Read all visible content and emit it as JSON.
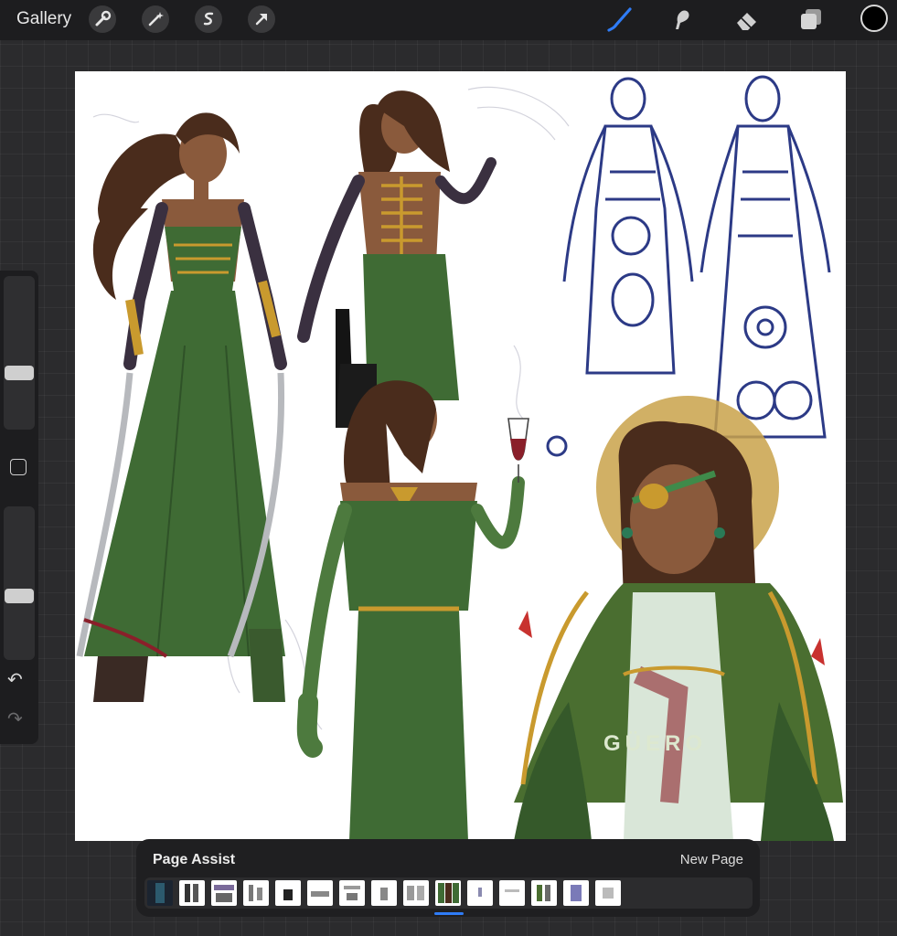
{
  "toolbar": {
    "gallery_label": "Gallery",
    "left_tools": [
      "wrench-icon",
      "magic-wand-icon",
      "selection-icon",
      "transform-arrow-icon"
    ],
    "right_tools": [
      "brush-icon",
      "smudge-icon",
      "eraser-icon",
      "layers-icon"
    ],
    "active_tool": "brush-icon",
    "current_color": "#000000",
    "accent_color": "#2f7cf6"
  },
  "canvas": {
    "watermark": "GÜERO",
    "colors": {
      "dress_green": "#3f6b34",
      "gold": "#c99a2e",
      "skin": "#8a5a3c",
      "hair": "#4a2c1c",
      "sketch_blue": "#2c3a86",
      "wine": "#8a1f2a"
    }
  },
  "sidebar": {
    "brush_size_level": 0.62,
    "opacity_level": 0.58,
    "undo_icon": "undo-icon",
    "redo_icon": "redo-icon"
  },
  "page_assist": {
    "title": "Page Assist",
    "new_page_label": "New Page",
    "page_count": 15,
    "selected_page": 10
  }
}
